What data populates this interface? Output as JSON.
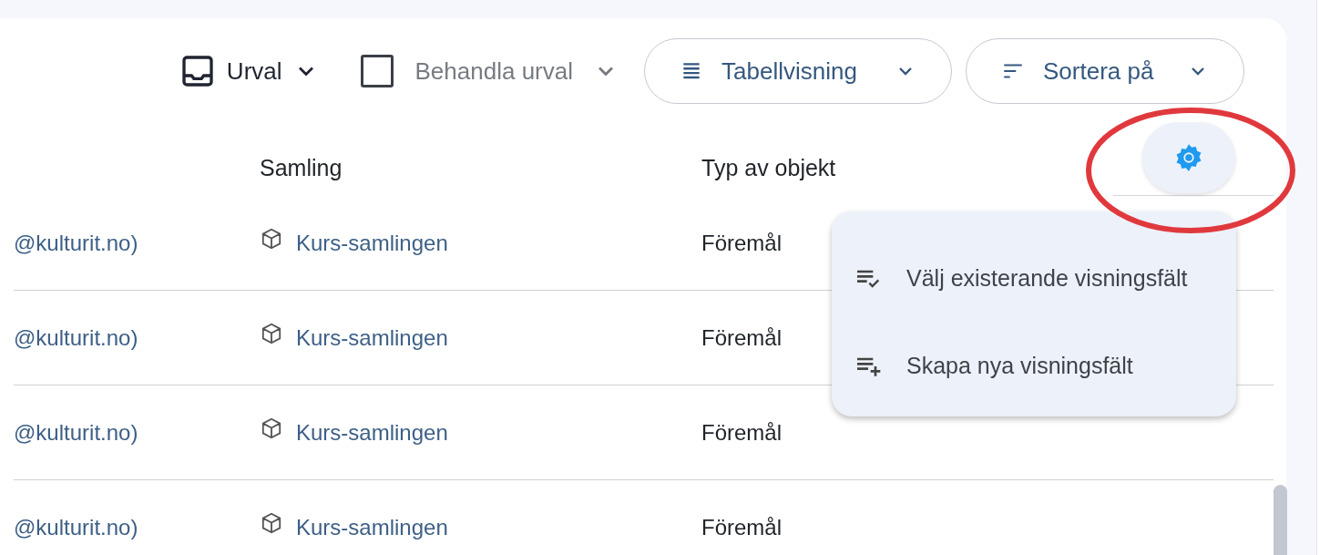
{
  "toolbar": {
    "selection": {
      "label": "Urval"
    },
    "bulk_action": {
      "label": "Behandla urval",
      "checked": false,
      "disabled": true
    },
    "buttons": [
      {
        "kind": "view",
        "label": "Tabellvisning"
      },
      {
        "kind": "sort",
        "label": "Sortera på"
      }
    ]
  },
  "table": {
    "columns": [
      "Samling",
      "Typ av objekt"
    ],
    "rows": [
      {
        "column_1": "@kulturit.no)",
        "collection": "Kurs-samlingen",
        "object_type": "Föremål"
      },
      {
        "column_1": "@kulturit.no)",
        "collection": "Kurs-samlingen",
        "object_type": "Föremål"
      },
      {
        "column_1": "@kulturit.no)",
        "collection": "Kurs-samlingen",
        "object_type": "Föremål"
      },
      {
        "column_1": "@kulturit.no)",
        "collection": "Kurs-samlingen",
        "object_type": "Föremål"
      }
    ]
  },
  "settings_menu": {
    "items": [
      {
        "kind": "select",
        "label": "Välj existerande visningsfält"
      },
      {
        "kind": "create",
        "label": "Skapa nya visningsfält"
      }
    ]
  }
}
